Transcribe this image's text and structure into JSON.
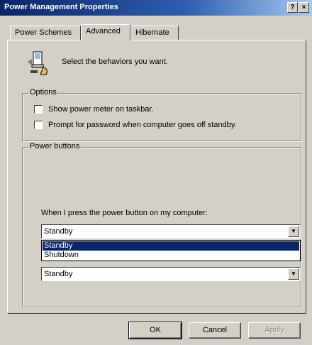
{
  "window": {
    "title": "Power Management Properties",
    "help_glyph": "?",
    "close_glyph": "×"
  },
  "tabs": [
    {
      "label": "Power Schemes",
      "active": false
    },
    {
      "label": "Advanced",
      "active": true
    },
    {
      "label": "Hibernate",
      "active": false
    }
  ],
  "header": {
    "text": "Select the behaviors you want.",
    "icon": "computer-power-icon"
  },
  "options": {
    "label": "Options",
    "items": [
      {
        "label": "Show power meter on taskbar.",
        "checked": false
      },
      {
        "label": "Prompt for password when computer goes off standby.",
        "checked": false
      }
    ]
  },
  "power_buttons": {
    "label": "Power buttons",
    "power_button_prompt": "When I press the power button on my computer:",
    "power_button_value": "Standby",
    "dropdown_options": [
      "Standby",
      "Shutdown"
    ],
    "dropdown_selected": "Standby",
    "second_value": "Standby"
  },
  "buttons": {
    "ok": "OK",
    "cancel": "Cancel",
    "apply": "Apply"
  },
  "colors": {
    "titlebar_start": "#0a246a",
    "face": "#d4d0c8",
    "selection": "#0a246a"
  }
}
